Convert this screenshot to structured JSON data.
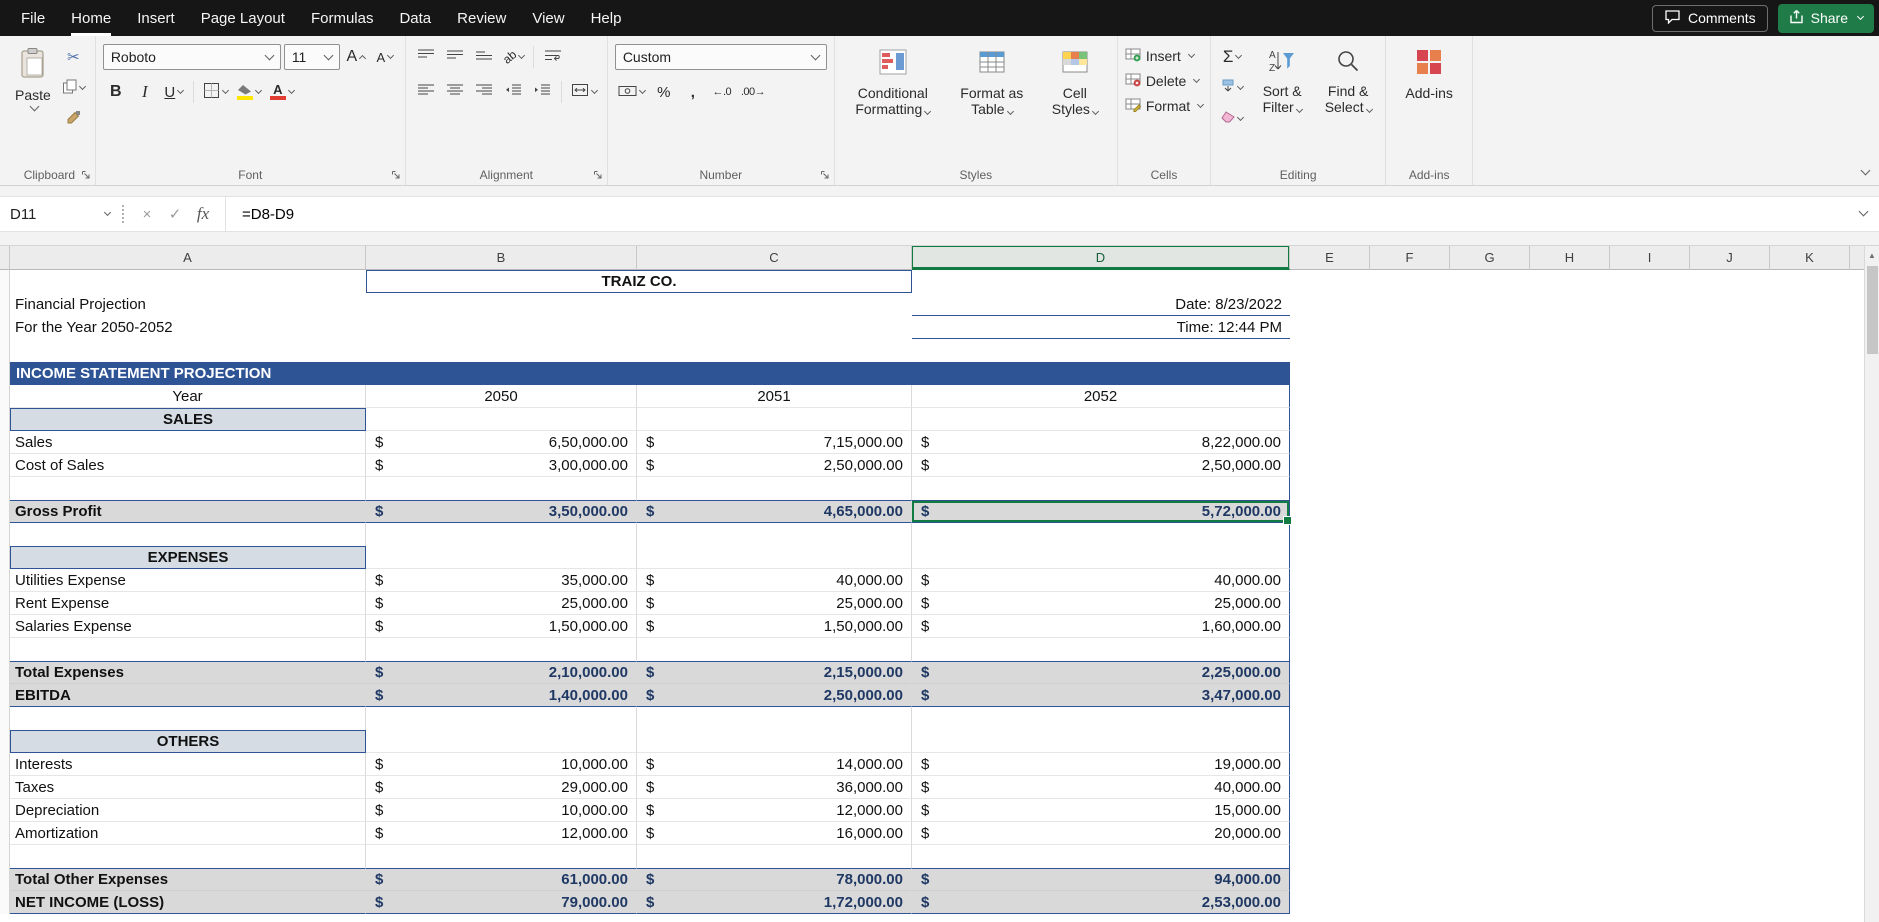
{
  "colors": {
    "accent_blue": "#2F5496",
    "selection_green": "#107C41",
    "share_green": "#1F7B47",
    "menubar_bg": "#161616",
    "total_row_bg": "#D9D9D9",
    "section_cell_bg": "#D6DCE4",
    "total_value_text": "#1F3864"
  },
  "menubar": {
    "items": [
      "File",
      "Home",
      "Insert",
      "Page Layout",
      "Formulas",
      "Data",
      "Review",
      "View",
      "Help"
    ],
    "active_item": "Home",
    "comments_label": "Comments",
    "share_label": "Share"
  },
  "ribbon": {
    "clipboard": {
      "paste_label": "Paste",
      "group_label": "Clipboard"
    },
    "font": {
      "font_name": "Roboto",
      "font_size": "11",
      "bold": "B",
      "italic": "I",
      "underline": "U",
      "group_label": "Font"
    },
    "alignment": {
      "group_label": "Alignment"
    },
    "number": {
      "format": "Custom",
      "percent": "%",
      "comma": ",",
      "increase_decimal": "←.0",
      "decrease_decimal": ".00→",
      "group_label": "Number"
    },
    "styles": {
      "conditional_label": "Conditional Formatting",
      "table_label": "Format as Table",
      "cell_styles_label": "Cell Styles",
      "group_label": "Styles"
    },
    "cells": {
      "insert_label": "Insert",
      "delete_label": "Delete",
      "format_label": "Format",
      "group_label": "Cells"
    },
    "editing": {
      "autosum": "Σ",
      "sort_filter_label": "Sort & Filter",
      "find_select_label": "Find & Select",
      "group_label": "Editing"
    },
    "addins": {
      "button_label": "Add-ins",
      "group_label": "Add-ins"
    }
  },
  "formula_bar": {
    "name_box": "D11",
    "fx_label": "fx",
    "formula": "=D8-D9"
  },
  "sheet": {
    "column_headers": [
      "A",
      "B",
      "C",
      "D",
      "E",
      "F",
      "G",
      "H",
      "I",
      "J",
      "K"
    ],
    "selected_column": "D",
    "selected_cell": "D11",
    "currency": "$",
    "rows": [
      {
        "type": "title",
        "b": "TRAIZ CO."
      },
      {
        "type": "info",
        "a": "Financial Projection",
        "d": "Date: 8/23/2022"
      },
      {
        "type": "info",
        "a": "For the Year 2050-2052",
        "d": "Time: 12:44 PM"
      },
      {
        "type": "blank_out"
      },
      {
        "type": "bar",
        "a": "INCOME STATEMENT PROJECTION"
      },
      {
        "type": "year",
        "a": "Year",
        "b": "2050",
        "c": "2051",
        "d": "2052"
      },
      {
        "type": "section",
        "a": "SALES"
      },
      {
        "type": "data",
        "a": "Sales",
        "b": "6,50,000.00",
        "c": "7,15,000.00",
        "d": "8,22,000.00"
      },
      {
        "type": "data",
        "a": "Cost of Sales",
        "b": "3,00,000.00",
        "c": "2,50,000.00",
        "d": "2,50,000.00"
      },
      {
        "type": "blank"
      },
      {
        "type": "total",
        "a": "Gross Profit",
        "b": "3,50,000.00",
        "c": "4,65,000.00",
        "d": "5,72,000.00",
        "selected": "d"
      },
      {
        "type": "blank"
      },
      {
        "type": "section",
        "a": "EXPENSES"
      },
      {
        "type": "data",
        "a": "Utilities Expense",
        "b": "35,000.00",
        "c": "40,000.00",
        "d": "40,000.00"
      },
      {
        "type": "data",
        "a": "Rent Expense",
        "b": "25,000.00",
        "c": "25,000.00",
        "d": "25,000.00"
      },
      {
        "type": "data",
        "a": "Salaries Expense",
        "b": "1,50,000.00",
        "c": "1,50,000.00",
        "d": "1,60,000.00"
      },
      {
        "type": "blank"
      },
      {
        "type": "total",
        "a": "Total Expenses",
        "b": "2,10,000.00",
        "c": "2,15,000.00",
        "d": "2,25,000.00",
        "group": "first"
      },
      {
        "type": "total",
        "a": "EBITDA",
        "b": "1,40,000.00",
        "c": "2,50,000.00",
        "d": "3,47,000.00",
        "group": "last"
      },
      {
        "type": "blank"
      },
      {
        "type": "section",
        "a": "OTHERS"
      },
      {
        "type": "data",
        "a": "Interests",
        "b": "10,000.00",
        "c": "14,000.00",
        "d": "19,000.00"
      },
      {
        "type": "data",
        "a": "Taxes",
        "b": "29,000.00",
        "c": "36,000.00",
        "d": "40,000.00"
      },
      {
        "type": "data",
        "a": "Depreciation",
        "b": "10,000.00",
        "c": "12,000.00",
        "d": "15,000.00"
      },
      {
        "type": "data",
        "a": "Amortization",
        "b": "12,000.00",
        "c": "16,000.00",
        "d": "20,000.00"
      },
      {
        "type": "blank"
      },
      {
        "type": "total",
        "a": "Total Other Expenses",
        "b": "61,000.00",
        "c": "78,000.00",
        "d": "94,000.00",
        "group": "first"
      },
      {
        "type": "total",
        "a": "NET INCOME (LOSS)",
        "b": "79,000.00",
        "c": "1,72,000.00",
        "d": "2,53,000.00",
        "group": "last"
      }
    ]
  }
}
